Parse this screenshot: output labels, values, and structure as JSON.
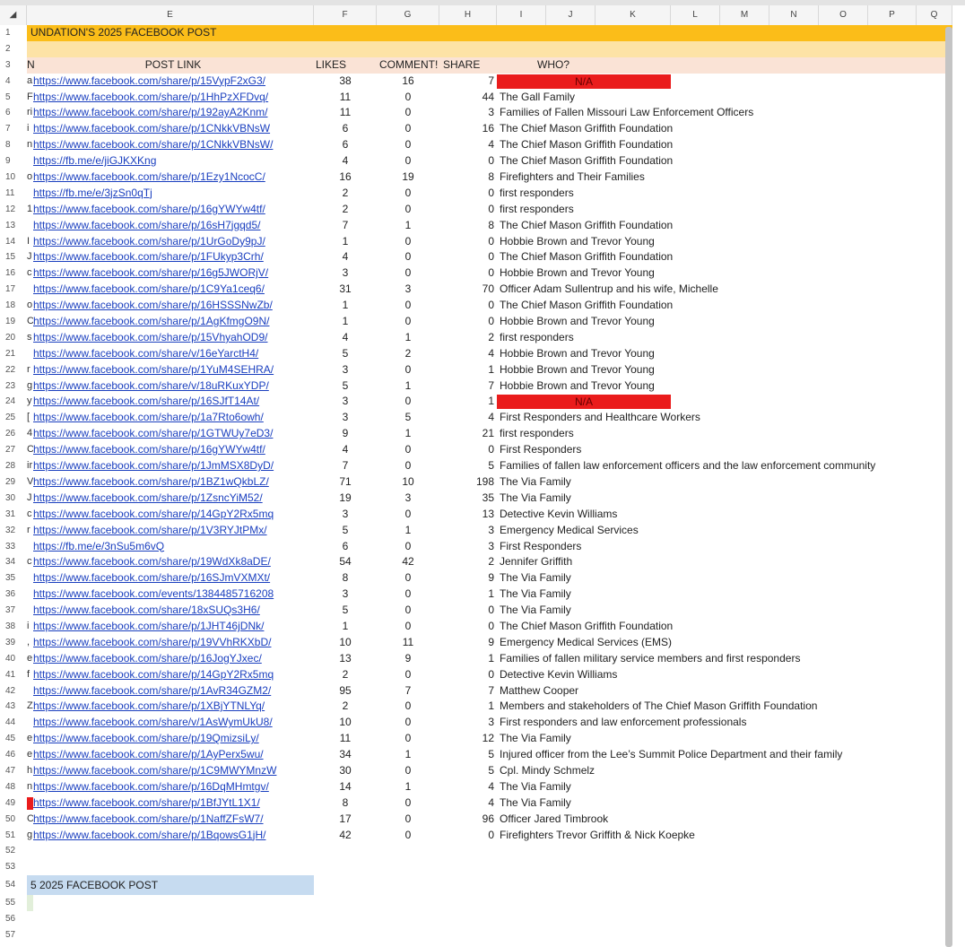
{
  "columns": [
    "E",
    "F",
    "G",
    "H",
    "I",
    "J",
    "K",
    "L",
    "M",
    "N",
    "O",
    "P",
    "Q"
  ],
  "title_row": {
    "row_num": "1",
    "text": "UNDATION'S 2025 FACEBOOK POST"
  },
  "header_row": {
    "row_num": "3",
    "d": "N",
    "post_link": "POST LINK",
    "likes": "LIKES",
    "comments": "COMMENT!",
    "share": "SHARE",
    "who": "WHO?"
  },
  "rows": [
    {
      "n": "4",
      "d": "a",
      "link": "https://www.facebook.com/share/p/15VypF2xG3/",
      "likes": "38",
      "comments": "16",
      "share": "7",
      "who": "N/A",
      "na": true
    },
    {
      "n": "5",
      "d": "F",
      "link": "https://www.facebook.com/share/p/1HhPzXFDvq/",
      "likes": "11",
      "comments": "0",
      "share": "44",
      "who": "The Gall Family"
    },
    {
      "n": "6",
      "d": "ri",
      "link": "https://www.facebook.com/share/p/192ayA2Knm/",
      "likes": "11",
      "comments": "0",
      "share": "3",
      "who": "Families of Fallen Missouri Law Enforcement Officers"
    },
    {
      "n": "7",
      "d": "i",
      "link": "https://www.facebook.com/share/p/1CNkkVBNsW",
      "likes": "6",
      "comments": "0",
      "share": "16",
      "who": "The Chief Mason Griffith Foundation"
    },
    {
      "n": "8",
      "d": "n",
      "link": "https://www.facebook.com/share/p/1CNkkVBNsW/",
      "likes": "6",
      "comments": "0",
      "share": "4",
      "who": "The Chief Mason Griffith Foundation"
    },
    {
      "n": "9",
      "d": "",
      "link": "https://fb.me/e/jiGJKXKng",
      "likes": "4",
      "comments": "0",
      "share": "0",
      "who": "The Chief Mason Griffith Foundation"
    },
    {
      "n": "10",
      "d": "o",
      "link": "https://www.facebook.com/share/p/1Ezy1NcocC/",
      "likes": "16",
      "comments": "19",
      "share": "8",
      "who": "Firefighters and Their Families"
    },
    {
      "n": "11",
      "d": "",
      "link": "https://fb.me/e/3jzSn0qTj",
      "likes": "2",
      "comments": "0",
      "share": "0",
      "who": "first responders"
    },
    {
      "n": "12",
      "d": "1",
      "link": "https://www.facebook.com/share/p/16gYWYw4tf/",
      "likes": "2",
      "comments": "0",
      "share": "0",
      "who": "first responders"
    },
    {
      "n": "13",
      "d": "",
      "link": "https://www.facebook.com/share/p/16sH7jgqd5/",
      "likes": "7",
      "comments": "1",
      "share": "8",
      "who": "The Chief Mason Griffith Foundation"
    },
    {
      "n": "14",
      "d": "I",
      "link": "https://www.facebook.com/share/p/1UrGoDy9pJ/",
      "likes": "1",
      "comments": "0",
      "share": "0",
      "who": "Hobbie Brown and Trevor Young"
    },
    {
      "n": "15",
      "d": "J",
      "link": "https://www.facebook.com/share/p/1FUkyp3Crh/",
      "likes": "4",
      "comments": "0",
      "share": "0",
      "who": "The Chief Mason Griffith Foundation"
    },
    {
      "n": "16",
      "d": "c",
      "link": "https://www.facebook.com/share/p/16g5JWORjV/",
      "likes": "3",
      "comments": "0",
      "share": "0",
      "who": "Hobbie Brown and Trevor Young"
    },
    {
      "n": "17",
      "d": "",
      "link": "https://www.facebook.com/share/p/1C9Ya1ceq6/",
      "likes": "31",
      "comments": "3",
      "share": "70",
      "who": "Officer Adam Sullentrup and his wife, Michelle"
    },
    {
      "n": "18",
      "d": "o",
      "link": "https://www.facebook.com/share/p/16HSSSNwZb/",
      "likes": "1",
      "comments": "0",
      "share": "0",
      "who": "The Chief Mason Griffith Foundation"
    },
    {
      "n": "19",
      "d": "C",
      "link": "https://www.facebook.com/share/p/1AgKfmgO9N/",
      "likes": "1",
      "comments": "0",
      "share": "0",
      "who": "Hobbie Brown and Trevor Young"
    },
    {
      "n": "20",
      "d": "s",
      "link": "https://www.facebook.com/share/p/15VhyahOD9/",
      "likes": "4",
      "comments": "1",
      "share": "2",
      "who": "first responders"
    },
    {
      "n": "21",
      "d": "",
      "link": "https://www.facebook.com/share/v/16eYarctH4/",
      "likes": "5",
      "comments": "2",
      "share": "4",
      "who": "Hobbie Brown and Trevor Young"
    },
    {
      "n": "22",
      "d": "r",
      "link": "https://www.facebook.com/share/p/1YuM4SEHRA/",
      "likes": "3",
      "comments": "0",
      "share": "1",
      "who": "Hobbie Brown and Trevor Young"
    },
    {
      "n": "23",
      "d": "g",
      "link": "https://www.facebook.com/share/v/18uRKuxYDP/",
      "likes": "5",
      "comments": "1",
      "share": "7",
      "who": "Hobbie Brown and Trevor Young"
    },
    {
      "n": "24",
      "d": "y",
      "link": "https://www.facebook.com/share/p/16SJfT14At/",
      "likes": "3",
      "comments": "0",
      "share": "1",
      "who": "N/A",
      "na": true
    },
    {
      "n": "25",
      "d": "[",
      "link": "https://www.facebook.com/share/p/1a7Rto6owh/",
      "likes": "3",
      "comments": "5",
      "share": "4",
      "who": "First Responders and Healthcare Workers"
    },
    {
      "n": "26",
      "d": "4",
      "link": "https://www.facebook.com/share/p/1GTWUy7eD3/",
      "likes": "9",
      "comments": "1",
      "share": "21",
      "who": "first responders"
    },
    {
      "n": "27",
      "d": "C",
      "link": "https://www.facebook.com/share/p/16gYWYw4tf/",
      "likes": "4",
      "comments": "0",
      "share": "0",
      "who": "First Responders"
    },
    {
      "n": "28",
      "d": "ir",
      "link": "https://www.facebook.com/share/p/1JmMSX8DyD/",
      "likes": "7",
      "comments": "0",
      "share": "5",
      "who": "Families of fallen law enforcement officers and the law enforcement community"
    },
    {
      "n": "29",
      "d": "V",
      "link": "https://www.facebook.com/share/p/1BZ1wQkbLZ/",
      "likes": "71",
      "comments": "10",
      "share": "198",
      "who": "The Via Family"
    },
    {
      "n": "30",
      "d": "J",
      "link": "https://www.facebook.com/share/p/1ZsncYiM52/",
      "likes": "19",
      "comments": "3",
      "share": "35",
      "who": "The Via Family"
    },
    {
      "n": "31",
      "d": "c",
      "link": "https://www.facebook.com/share/p/14GpY2Rx5mq",
      "likes": "3",
      "comments": "0",
      "share": "13",
      "who": "Detective Kevin Williams"
    },
    {
      "n": "32",
      "d": "r",
      "link": "https://www.facebook.com/share/p/1V3RYJtPMx/",
      "likes": "5",
      "comments": "1",
      "share": "3",
      "who": "Emergency Medical Services"
    },
    {
      "n": "33",
      "d": "",
      "link": "https://fb.me/e/3nSu5m6vQ",
      "likes": "6",
      "comments": "0",
      "share": "3",
      "who": "First Responders"
    },
    {
      "n": "34",
      "d": "c",
      "link": "https://www.facebook.com/share/p/19WdXk8aDE/",
      "likes": "54",
      "comments": "42",
      "share": "2",
      "who": "Jennifer Griffith"
    },
    {
      "n": "35",
      "d": "",
      "link": "https://www.facebook.com/share/p/16SJmVXMXt/",
      "likes": "8",
      "comments": "0",
      "share": "9",
      "who": "The Via Family"
    },
    {
      "n": "36",
      "d": "",
      "link": "https://www.facebook.com/events/1384485716208",
      "likes": "3",
      "comments": "0",
      "share": "1",
      "who": "The Via Family"
    },
    {
      "n": "37",
      "d": "",
      "link": "https://www.facebook.com/share/18xSUQs3H6/",
      "likes": "5",
      "comments": "0",
      "share": "0",
      "who": "The Via Family"
    },
    {
      "n": "38",
      "d": "i",
      "link": "https://www.facebook.com/share/p/1JHT46jDNk/",
      "likes": "1",
      "comments": "0",
      "share": "0",
      "who": "The Chief Mason Griffith Foundation"
    },
    {
      "n": "39",
      "d": ",",
      "link": "https://www.facebook.com/share/p/19VVhRKXbD/",
      "likes": "10",
      "comments": "11",
      "share": "9",
      "who": "Emergency Medical Services (EMS)"
    },
    {
      "n": "40",
      "d": "e",
      "link": "https://www.facebook.com/share/p/16JogYJxec/",
      "likes": "13",
      "comments": "9",
      "share": "1",
      "who": "Families of fallen military service members and first responders"
    },
    {
      "n": "41",
      "d": "f",
      "link": "https://www.facebook.com/share/p/14GpY2Rx5mq",
      "likes": "2",
      "comments": "0",
      "share": "0",
      "who": "Detective Kevin Williams"
    },
    {
      "n": "42",
      "d": "",
      "link": "https://www.facebook.com/share/p/1AvR34GZM2/",
      "likes": "95",
      "comments": "7",
      "share": "7",
      "who": "Matthew Cooper"
    },
    {
      "n": "43",
      "d": "Z",
      "link": "https://www.facebook.com/share/p/1XBjYTNLYq/",
      "likes": "2",
      "comments": "0",
      "share": "1",
      "who": "Members and stakeholders of The Chief Mason Griffith Foundation"
    },
    {
      "n": "44",
      "d": "",
      "link": "https://www.facebook.com/share/v/1AsWymUkU8/",
      "likes": "10",
      "comments": "0",
      "share": "3",
      "who": "First responders and law enforcement professionals"
    },
    {
      "n": "45",
      "d": "e",
      "link": "https://www.facebook.com/share/p/19QmizsiLy/",
      "likes": "11",
      "comments": "0",
      "share": "12",
      "who": "The Via Family"
    },
    {
      "n": "46",
      "d": "e",
      "link": "https://www.facebook.com/share/p/1AyPerx5wu/",
      "likes": "34",
      "comments": "1",
      "share": "5",
      "who": "Injured officer from the Lee’s Summit Police Department and their family"
    },
    {
      "n": "47",
      "d": "h",
      "link": "https://www.facebook.com/share/p/1C9MWYMnzW",
      "likes": "30",
      "comments": "0",
      "share": "5",
      "who": "Cpl. Mindy Schmelz"
    },
    {
      "n": "48",
      "d": "n",
      "link": "https://www.facebook.com/share/p/16DqMHmtgv/",
      "likes": "14",
      "comments": "1",
      "share": "4",
      "who": "The Via Family"
    },
    {
      "n": "49",
      "d": "",
      "link": "https://www.facebook.com/share/p/1BfJYtL1X1/",
      "likes": "8",
      "comments": "0",
      "share": "4",
      "who": "The Via Family",
      "redmark": true
    },
    {
      "n": "50",
      "d": "C",
      "link": "https://www.facebook.com/share/p/1NaffZFsW7/",
      "likes": "17",
      "comments": "0",
      "share": "96",
      "who": "Officer Jared Timbrook"
    },
    {
      "n": "51",
      "d": "g",
      "link": "https://www.facebook.com/share/p/1BqowsG1jH/",
      "likes": "42",
      "comments": "0",
      "share": "0",
      "who": "Firefighters Trevor Griffith & Nick Koepke"
    }
  ],
  "empty_rows": [
    "52",
    "53"
  ],
  "section2": {
    "row_num": "54",
    "text": "5 2025 FACEBOOK POST"
  },
  "tail_rows": [
    "55",
    "56",
    "57"
  ],
  "colors": {
    "title_bg": "#fbbd19",
    "band_bg": "#fde3a6",
    "header_bg": "#fae3d6",
    "na_bg": "#ea1c1c",
    "link": "#1a3fbf",
    "section2_bg": "#c6dbf0"
  }
}
